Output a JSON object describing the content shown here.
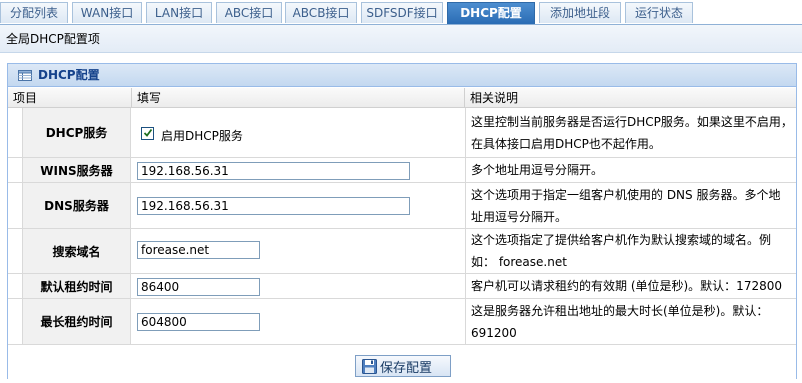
{
  "tabs": [
    {
      "label": "分配列表",
      "active": false
    },
    {
      "label": "WAN接口",
      "active": false
    },
    {
      "label": "LAN接口",
      "active": false
    },
    {
      "label": "ABC接口",
      "active": false
    },
    {
      "label": "ABCB接口",
      "active": false
    },
    {
      "label": "SDFSDF接口",
      "active": false
    },
    {
      "label": "DHCP配置",
      "active": true
    },
    {
      "label": "添加地址段",
      "active": false
    },
    {
      "label": "运行状态",
      "active": false
    }
  ],
  "subtitle": "全局DHCP配置项",
  "panel": {
    "title": "DHCP配置",
    "icon": "grid-icon",
    "columns": {
      "item": "项目",
      "fill": "填写",
      "desc": "相关说明"
    },
    "dhcp_service": {
      "label": "DHCP服务",
      "checkbox_label": "启用DHCP服务",
      "checked": true,
      "desc_line1": "这里控制当前服务器是否运行DHCP服务。如果这里不启用，",
      "desc_line2": "在具体接口启用DHCP也不起作用。"
    },
    "wins_server": {
      "label": "WINS服务器",
      "value": "192.168.56.31",
      "desc_line1": "多个地址用逗号分隔开。"
    },
    "dns_server": {
      "label": "DNS服务器",
      "value": "192.168.56.31",
      "desc_line1": "这个选项用于指定一组客户机使用的 DNS 服务器。多个地",
      "desc_line2": "址用逗号分隔开。"
    },
    "search_domain": {
      "label": "搜索域名",
      "value": "forease.net",
      "desc_line1": "这个选项指定了提供给客户机作为默认搜索域的域名。例",
      "desc_line2": "如：  forease.net"
    },
    "default_lease": {
      "label": "默认租约时间",
      "value": "86400",
      "desc_line1": "客户机可以请求租约的有效期 (单位是秒)。默认：172800"
    },
    "max_lease": {
      "label": "最长租约时间",
      "value": "604800",
      "desc_line1": "这是服务器允许租出地址的最大时长(单位是秒)。默认：",
      "desc_line2": "691200"
    },
    "save_label": "保存配置",
    "save_icon": "floppy-disk-icon"
  },
  "colors": {
    "active_tab": "#2a6cb4",
    "panel_title": "#15428b",
    "panel_border": "#99bbe8"
  }
}
